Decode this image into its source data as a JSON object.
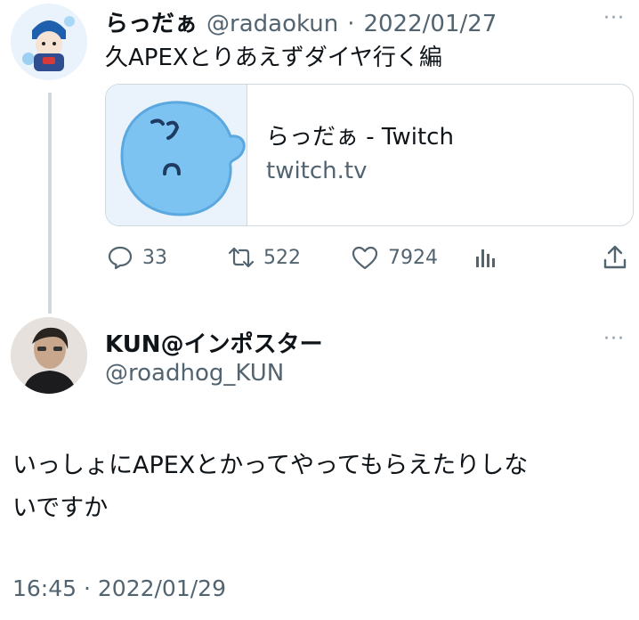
{
  "tweet1": {
    "display_name": "らっだぁ",
    "handle": "@radaokun",
    "separator": "·",
    "date": "2022/01/27",
    "more": "···",
    "text": "久APEXとりあえずダイヤ行く編",
    "card": {
      "title": "らっだぁ - Twitch",
      "domain": "twitch.tv"
    },
    "actions": {
      "replies": "33",
      "retweets": "522",
      "likes": "7924"
    }
  },
  "tweet2": {
    "display_name": "KUN@インポスター",
    "handle": "@roadhog_KUN",
    "more": "···",
    "text_line1": "いっしょにAPEXとかってやってもらえたりしな",
    "text_line2": "いですか",
    "timestamp": "16:45 · 2022/01/29"
  },
  "colors": {
    "text": "#0f1419",
    "secondary": "#536471",
    "border": "#cfd9de",
    "blob": "#7cc3f2"
  }
}
